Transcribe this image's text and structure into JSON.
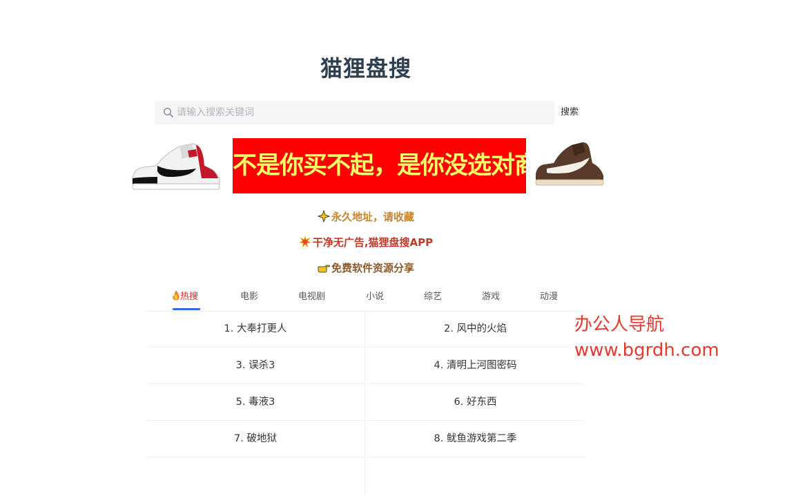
{
  "header": {
    "title": "猫狸盘搜"
  },
  "search": {
    "placeholder": "请输入搜索关键词",
    "value": "",
    "button_label": "搜索"
  },
  "banner": {
    "text": "不是你买不起，是你没选对商家"
  },
  "promos": [
    {
      "label": "永久地址，请收藏",
      "color": "#c9842a"
    },
    {
      "label": "干净无广告,猫狸盘搜APP",
      "color": "#c0392b"
    },
    {
      "label": "免费软件资源分享",
      "color": "#8a5a2c"
    }
  ],
  "tabs": [
    {
      "label": "热搜",
      "active": true
    },
    {
      "label": "电影"
    },
    {
      "label": "电视剧"
    },
    {
      "label": "小说"
    },
    {
      "label": "综艺"
    },
    {
      "label": "游戏"
    },
    {
      "label": "动漫"
    }
  ],
  "hot_list": [
    "1. 大奉打更人",
    "2. 风中的火焰",
    "3. 误杀3",
    "4. 清明上河图密码",
    "5. 毒液3",
    "6. 好东西",
    "7. 破地狱",
    "8. 鱿鱼游戏第二季"
  ],
  "watermark": {
    "line1": "办公人导航",
    "line2": "www.bgrdh.com"
  }
}
